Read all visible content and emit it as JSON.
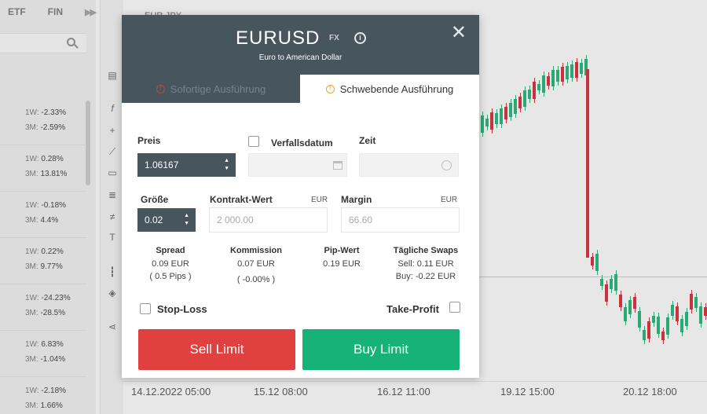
{
  "left_panel": {
    "tabs": [
      "ETF",
      "FIN"
    ],
    "rows": [
      {
        "l1": "1W:",
        "v1": "-2.33%",
        "l2": "3M:",
        "v2": "-2.59%"
      },
      {
        "l1": "1W:",
        "v1": "0.28%",
        "l2": "3M:",
        "v2": "13.81%"
      },
      {
        "l1": "1W:",
        "v1": "-0.18%",
        "l2": "3M:",
        "v2": "4.4%"
      },
      {
        "l1": "1W:",
        "v1": "0.22%",
        "l2": "3M:",
        "v2": "9.77%"
      },
      {
        "l1": "1W:",
        "v1": "-24.23%",
        "l2": "3M:",
        "v2": "-28.5%"
      },
      {
        "l1": "1W:",
        "v1": "6.83%",
        "l2": "3M:",
        "v2": "-1.04%"
      },
      {
        "l1": "1W:",
        "v1": "-2.18%",
        "l2": "3M:",
        "v2": "1.66%"
      }
    ]
  },
  "chart": {
    "symbol": "EUR JPY",
    "x_labels": [
      "14.12.2022 05:00",
      "15.12 08:00",
      "16.12 11:00",
      "19.12 15:00",
      "20.12 18:00"
    ],
    "up_color": "#2aa876",
    "down_color": "#c8323c"
  },
  "modal": {
    "title": "EURUSD",
    "type": "FX",
    "subtitle": "Euro to American Dollar",
    "tabs": {
      "instant": "Sofortige Ausführung",
      "pending": "Schwebende Ausführung"
    },
    "price_label": "Preis",
    "price_value": "1.06167",
    "expiry_label": "Verfallsdatum",
    "time_label": "Zeit",
    "size_label": "Größe",
    "size_value": "0.02",
    "contract_label": "Kontrakt-Wert",
    "contract_unit": "EUR",
    "contract_value": "2 000.00",
    "margin_label": "Margin",
    "margin_unit": "EUR",
    "margin_value": "66.60",
    "spread": {
      "title": "Spread",
      "v1": "0.09 EUR",
      "v2": "( 0.5 Pips )"
    },
    "commission": {
      "title": "Kommission",
      "v1": "0.07 EUR",
      "v2": "( -0.00% )"
    },
    "pip": {
      "title": "Pip-Wert",
      "v1": "0.19 EUR"
    },
    "swaps": {
      "title": "Tägliche Swaps",
      "v1": "Sell: 0.11 EUR",
      "v2": "Buy: -0.22 EUR"
    },
    "stop_loss": "Stop-Loss",
    "take_profit": "Take-Profit",
    "sell_label": "Sell Limit",
    "buy_label": "Buy Limit",
    "colors": {
      "header": "#47555d",
      "sell": "#e04040",
      "buy": "#16b277"
    }
  }
}
